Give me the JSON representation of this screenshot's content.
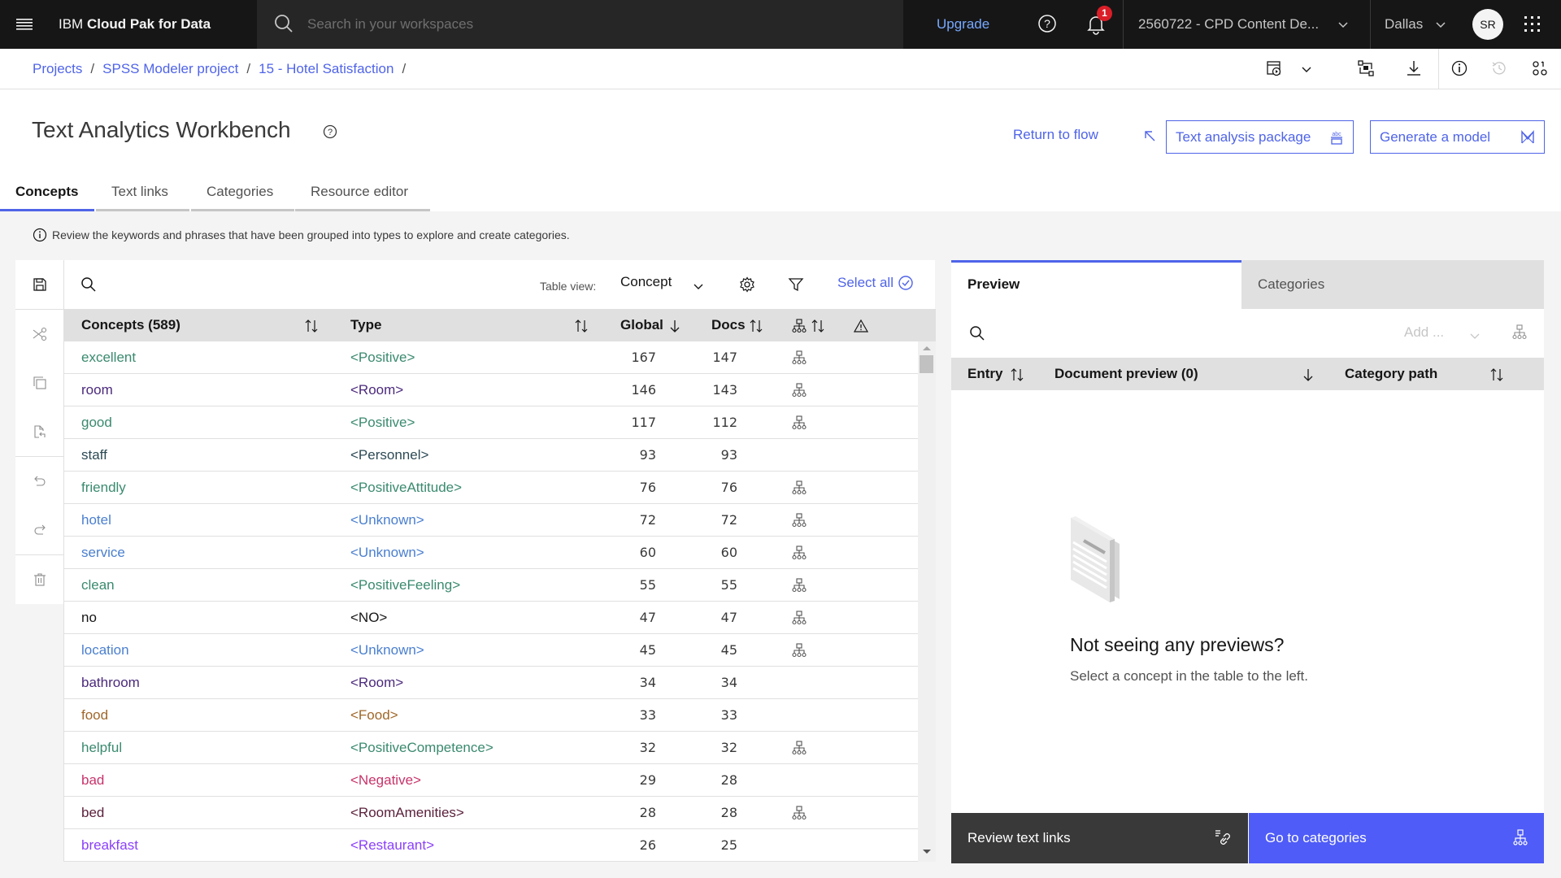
{
  "topbar": {
    "brand_prefix": "IBM",
    "brand_name": "Cloud Pak for Data",
    "search_placeholder": "Search in your workspaces",
    "upgrade_label": "Upgrade",
    "notification_count": "1",
    "account_label": "2560722 - CPD Content De...",
    "region_label": "Dallas",
    "avatar_initials": "SR"
  },
  "breadcrumb": {
    "items": [
      "Projects",
      "SPSS Modeler project",
      "15 - Hotel Satisfaction"
    ],
    "separator": "/"
  },
  "header": {
    "title": "Text Analytics Workbench",
    "return_label": "Return to flow",
    "package_label": "Text analysis package",
    "generate_label": "Generate a model"
  },
  "tabs": [
    {
      "label": "Concepts",
      "active": true
    },
    {
      "label": "Text links",
      "active": false
    },
    {
      "label": "Categories",
      "active": false
    },
    {
      "label": "Resource editor",
      "active": false
    }
  ],
  "info_text": "Review the keywords and phrases that have been grouped into types to explore and create categories.",
  "concepts_table": {
    "table_view_label": "Table view:",
    "table_view_value": "Concept",
    "select_all_label": "Select all",
    "columns": [
      "Concepts (589)",
      "Type",
      "Global",
      "Docs"
    ],
    "rows": [
      {
        "concept": "excellent",
        "type": "<Positive>",
        "global": "167",
        "docs": "147",
        "has_category": true,
        "color": "#3a8a6e"
      },
      {
        "concept": "room",
        "type": "<Room>",
        "global": "146",
        "docs": "143",
        "has_category": true,
        "color": "#4b2a7c"
      },
      {
        "concept": "good",
        "type": "<Positive>",
        "global": "117",
        "docs": "112",
        "has_category": true,
        "color": "#3a8a6e"
      },
      {
        "concept": "staff",
        "type": "<Personnel>",
        "global": "93",
        "docs": "93",
        "has_category": false,
        "color": "#2d4a55"
      },
      {
        "concept": "friendly",
        "type": "<PositiveAttitude>",
        "global": "76",
        "docs": "76",
        "has_category": true,
        "color": "#3a8a6e"
      },
      {
        "concept": "hotel",
        "type": "<Unknown>",
        "global": "72",
        "docs": "72",
        "has_category": true,
        "color": "#4a7fcf"
      },
      {
        "concept": "service",
        "type": "<Unknown>",
        "global": "60",
        "docs": "60",
        "has_category": true,
        "color": "#4a7fcf"
      },
      {
        "concept": "clean",
        "type": "<PositiveFeeling>",
        "global": "55",
        "docs": "55",
        "has_category": true,
        "color": "#3a8a6e"
      },
      {
        "concept": "no",
        "type": "<NO>",
        "global": "47",
        "docs": "47",
        "has_category": true,
        "color": "#161616"
      },
      {
        "concept": "location",
        "type": "<Unknown>",
        "global": "45",
        "docs": "45",
        "has_category": true,
        "color": "#4a7fcf"
      },
      {
        "concept": "bathroom",
        "type": "<Room>",
        "global": "34",
        "docs": "34",
        "has_category": false,
        "color": "#4b2a7c"
      },
      {
        "concept": "food",
        "type": "<Food>",
        "global": "33",
        "docs": "33",
        "has_category": false,
        "color": "#a0672a"
      },
      {
        "concept": "helpful",
        "type": "<PositiveCompetence>",
        "global": "32",
        "docs": "32",
        "has_category": true,
        "color": "#3a8a6e"
      },
      {
        "concept": "bad",
        "type": "<Negative>",
        "global": "29",
        "docs": "28",
        "has_category": false,
        "color": "#c8336a"
      },
      {
        "concept": "bed",
        "type": "<RoomAmenities>",
        "global": "28",
        "docs": "28",
        "has_category": true,
        "color": "#5a1f3a"
      },
      {
        "concept": "breakfast",
        "type": "<Restaurant>",
        "global": "26",
        "docs": "25",
        "has_category": false,
        "color": "#8a3ffc"
      }
    ]
  },
  "preview_panel": {
    "tabs": [
      "Preview",
      "Categories"
    ],
    "add_placeholder": "Add ...",
    "columns": [
      "Entry",
      "Document preview (0)",
      "Category path"
    ],
    "empty_title": "Not seeing any previews?",
    "empty_subtitle": "Select a concept in the table to the left.",
    "review_links_label": "Review text links",
    "go_categories_label": "Go to categories"
  },
  "colors": {
    "accent": "#4f64e8",
    "topbar_bg": "#161616",
    "header_row_bg": "#e0e0e0",
    "primary_button": "#4f5cf7",
    "secondary_button": "#393939"
  }
}
